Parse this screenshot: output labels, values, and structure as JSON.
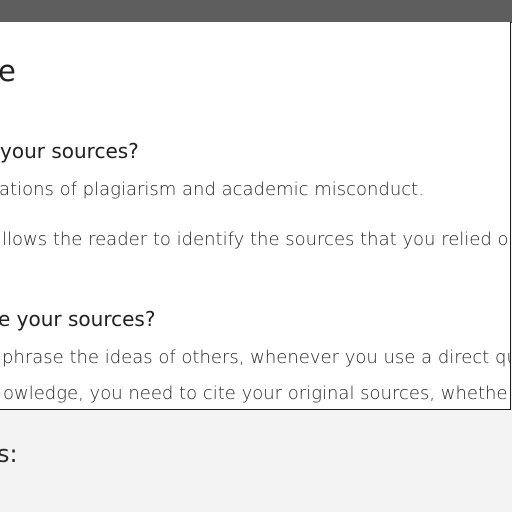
{
  "article": {
    "title": "e",
    "section1": {
      "heading": "your sources?",
      "paragraphs": [
        "ations of plagiarism and academic misconduct.",
        "llows the reader to identify the sources that you relied o"
      ]
    },
    "section2": {
      "heading": "e your sources?",
      "paragraphs": [
        "phrase the ideas of others, whenever you use a direct qu",
        "owledge, you need to cite your original sources, whethe"
      ]
    }
  },
  "below_box": {
    "heading": "s:"
  }
}
